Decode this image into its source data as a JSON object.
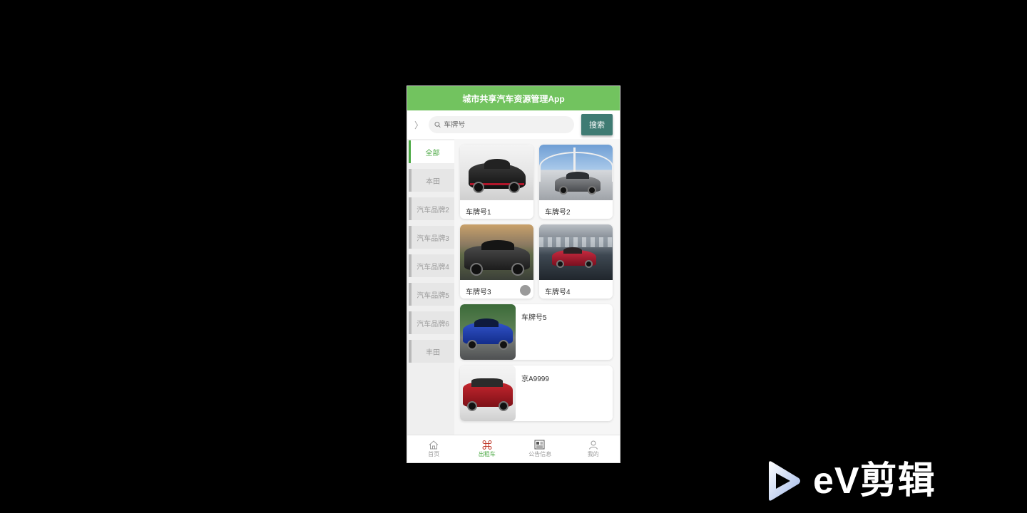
{
  "app": {
    "title": "城市共享汽车资源管理App"
  },
  "search": {
    "placeholder": "车牌号",
    "button_label": "搜索"
  },
  "categories": [
    {
      "label": "全部",
      "active": true
    },
    {
      "label": "本田"
    },
    {
      "label": "汽车品牌2"
    },
    {
      "label": "汽车品牌3"
    },
    {
      "label": "汽车品牌4"
    },
    {
      "label": "汽车品牌5"
    },
    {
      "label": "汽车品牌6"
    },
    {
      "label": "丰田"
    }
  ],
  "cars": [
    {
      "label": "车牌号1"
    },
    {
      "label": "车牌号2"
    },
    {
      "label": "车牌号3"
    },
    {
      "label": "车牌号4"
    },
    {
      "label": "车牌号5"
    },
    {
      "label": "京A9999"
    }
  ],
  "tabs": [
    {
      "label": "首页",
      "icon": "home-icon"
    },
    {
      "label": "出租车",
      "icon": "command-icon",
      "active": true
    },
    {
      "label": "公告信息",
      "icon": "newspaper-icon"
    },
    {
      "label": "我的",
      "icon": "user-icon"
    }
  ],
  "watermark": {
    "text": "eV剪辑"
  },
  "colors": {
    "header": "#72c35f",
    "search_button": "#3f7b73",
    "active_green": "#4aa842",
    "active_tab_icon": "#c0392b"
  }
}
